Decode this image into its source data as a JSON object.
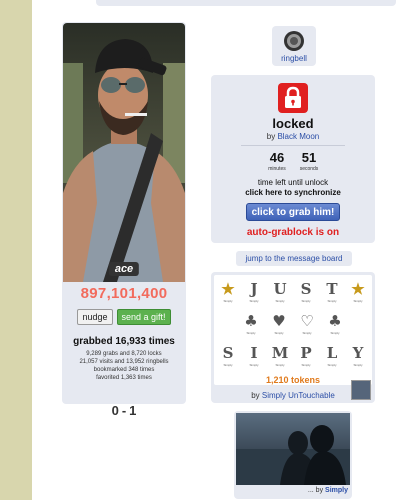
{
  "profile": {
    "name": "ace",
    "score": "897,101,400",
    "nudge_label": "nudge",
    "gift_label": "send a gift!",
    "grabbed": "grabbed 16,933 times",
    "stats": [
      "9,289 grabs and 8,720 locks",
      "21,057 visits and 13,952 ringbells",
      "bookmarked 348 times",
      "favorited 1,363 times"
    ],
    "record_left": "0",
    "record_sep": "-",
    "record_right": "1"
  },
  "ringbell": {
    "label": "ringbell",
    "icon": "ringbell-icon"
  },
  "lock": {
    "icon": "padlock-icon",
    "title": "locked",
    "by_prefix": "by",
    "by_name": "Black Moon",
    "minutes": "46",
    "minutes_unit": "minutes",
    "seconds": "51",
    "seconds_unit": "seconds",
    "time_left": "time left until unlock",
    "sync_link": "click here to synchronize",
    "grab_button": "click to grab him!",
    "auto_grab": "auto-grablock is on"
  },
  "message_board": {
    "label": "jump to the message board"
  },
  "gift": {
    "stickers": [
      {
        "glyph": "★",
        "cap": "Simply"
      },
      {
        "glyph": "J",
        "cap": "Simply"
      },
      {
        "glyph": "U",
        "cap": "Simply"
      },
      {
        "glyph": "S",
        "cap": "Simply"
      },
      {
        "glyph": "T",
        "cap": "Simply"
      },
      {
        "glyph": "★",
        "cap": "Simply"
      },
      {
        "glyph": "♣",
        "cap": "Simply"
      },
      {
        "glyph": "♥",
        "cap": "Simply"
      },
      {
        "glyph": "♡",
        "cap": "Simply"
      },
      {
        "glyph": "♣",
        "cap": "Simply"
      },
      {
        "glyph": "S",
        "cap": "Simply"
      },
      {
        "glyph": "I",
        "cap": "Simply"
      },
      {
        "glyph": "M",
        "cap": "Simply"
      },
      {
        "glyph": "P",
        "cap": "Simply"
      },
      {
        "glyph": "L",
        "cap": "Simply"
      },
      {
        "glyph": "Y",
        "cap": "Simply"
      }
    ],
    "tokens": "1,210 tokens",
    "by_prefix": "by",
    "by_name": "Simply UnTouchable"
  },
  "video": {
    "by_prefix": "... by",
    "by_name": "Simply"
  },
  "colors": {
    "accent_blue": "#2b4ea6",
    "score_red": "#f26b5d",
    "alert_red": "#e02020",
    "token_orange": "#e07a1c",
    "gift_green": "#5cb14e",
    "panel_bg": "#e6e9f1",
    "stripe": "#d8d6ad"
  }
}
